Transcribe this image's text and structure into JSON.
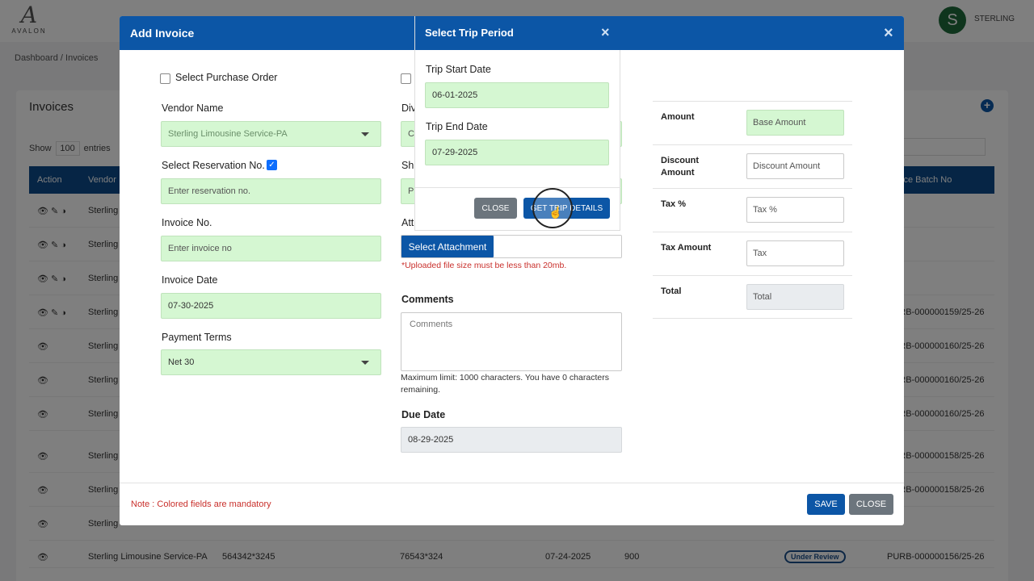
{
  "brand": {
    "logo_mark": "A",
    "logo_text": "AVALON"
  },
  "user": {
    "initial": "S",
    "name": "STERLING"
  },
  "breadcrumb": {
    "item1": "Dashboard",
    "sep": "/",
    "item2": "Invoices"
  },
  "background_page": {
    "title": "Invoices",
    "show_label": "Show",
    "entries_count": "100",
    "entries_label": "entries",
    "columns": {
      "action": "Action",
      "vendor": "Vendor",
      "batch": "ice Batch No"
    },
    "rows": [
      {
        "vendor": "Sterling",
        "batch": ""
      },
      {
        "vendor": "Sterling",
        "batch": ""
      },
      {
        "vendor": "Sterling",
        "batch": ""
      },
      {
        "vendor": "Sterling",
        "batch": "PURB-000000159/25-26"
      },
      {
        "vendor": "Sterling",
        "batch": "PURB-000000160/25-26"
      },
      {
        "vendor": "Sterling",
        "batch": "PURB-000000160/25-26"
      },
      {
        "vendor": "Sterling",
        "batch": "PURB-000000160/25-26"
      },
      {
        "vendor": "Sterling",
        "batch": "PURB-000000158/25-26"
      },
      {
        "vendor": "Sterling",
        "batch": "PURB-000000158/25-26"
      },
      {
        "vendor": "Sterling",
        "batch": ""
      }
    ],
    "last_row": {
      "vendor": "Sterling Limousine Service-PA",
      "ref1": "564342*3245",
      "ref2": "76543*324",
      "date": "07-24-2025",
      "amount": "900",
      "status": "Under Review",
      "batch": "PURB-000000156/25-26"
    }
  },
  "modal": {
    "title": "Add Invoice",
    "close_glyph": "×",
    "select_po_label": "Select Purchase Order",
    "vendor_label": "Vendor Name",
    "vendor_value": "Sterling Limousine Service-PA",
    "reservation_label": "Select Reservation No.",
    "reservation_checked_glyph": "✓",
    "reservation_placeholder": "Enter reservation no.",
    "invoice_no_label": "Invoice No.",
    "invoice_no_placeholder": "Enter invoice no",
    "invoice_date_label": "Invoice Date",
    "invoice_date_value": "07-30-2025",
    "payment_terms_label": "Payment Terms",
    "payment_terms_value": "Net 30",
    "division_label_partial": "Div",
    "division_value_partial": "C",
    "ship_label_partial": "Sh",
    "ship_value_partial": "P",
    "attach_label_partial": "Att",
    "attach_button": "Select Attachment",
    "attach_hint": "*Uploaded file size must be less than 20mb.",
    "comments_label": "Comments",
    "comments_placeholder": "Comments",
    "comments_limit_line1": "Maximum limit: 1000 characters. You have 0 characters",
    "comments_limit_line2": "remaining.",
    "due_date_label": "Due Date",
    "due_date_value": "08-29-2025",
    "amounts": [
      {
        "label": "Amount",
        "placeholder": "Base Amount",
        "style": "green"
      },
      {
        "label": "Discount Amount",
        "placeholder": "Discount Amount",
        "style": "white"
      },
      {
        "label": "Tax %",
        "placeholder": "Tax %",
        "style": "white"
      },
      {
        "label": "Tax Amount",
        "placeholder": "Tax",
        "style": "white"
      },
      {
        "label": "Total",
        "placeholder": "Total",
        "style": "grey"
      }
    ],
    "note": "Note : Colored fields are mandatory",
    "save_button": "SAVE",
    "close_button": "CLOSE"
  },
  "trip_popup": {
    "title": "Select Trip Period",
    "close_glyph": "×",
    "start_label": "Trip Start Date",
    "start_value": "06-01-2025",
    "end_label": "Trip End Date",
    "end_value": "07-29-2025",
    "close_button": "CLOSE",
    "get_button": "GET TRIP DETAILS"
  },
  "colors": {
    "primary": "#0c56a6",
    "mandatory_field": "#d5f7d2",
    "secondary_button": "#6c757d",
    "warning_text": "#c9302c"
  }
}
